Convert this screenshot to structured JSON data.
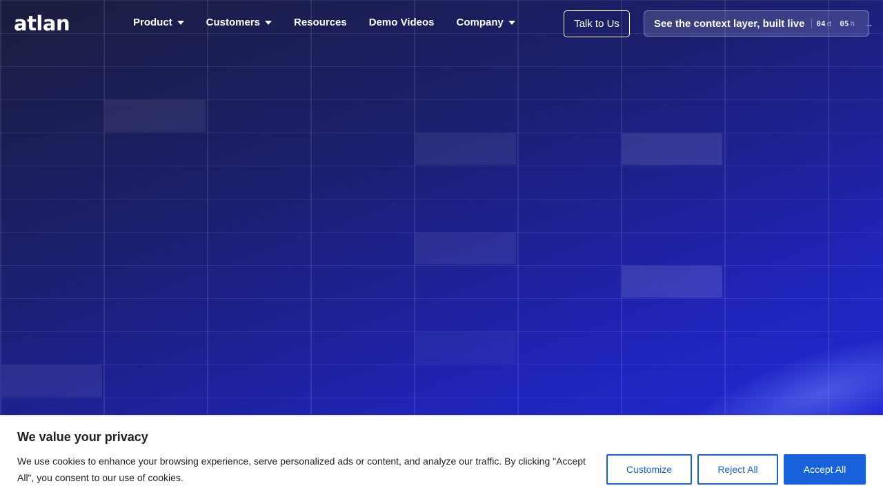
{
  "brand": {
    "logo_text": "atlan"
  },
  "nav": {
    "items": [
      {
        "label": "Product",
        "has_dropdown": true
      },
      {
        "label": "Customers",
        "has_dropdown": true
      },
      {
        "label": "Resources",
        "has_dropdown": false
      },
      {
        "label": "Demo Videos",
        "has_dropdown": false
      },
      {
        "label": "Company",
        "has_dropdown": true
      }
    ]
  },
  "header": {
    "talk_label": "Talk to Us",
    "context_label": "See the context layer, built live",
    "countdown": {
      "days": "04",
      "days_unit": "d",
      "hours": "05",
      "hours_unit": "h"
    },
    "arrow_icon": "arrow-right-icon"
  },
  "cookie": {
    "title": "We value your privacy",
    "text": "We use cookies to enhance your browsing experience, serve personalized ads or content, and analyze our traffic. By clicking \"Accept All\", you consent to our use of cookies.",
    "customize_label": "Customize",
    "reject_label": "Reject All",
    "accept_label": "Accept All",
    "accent_color": "#1863dc"
  }
}
